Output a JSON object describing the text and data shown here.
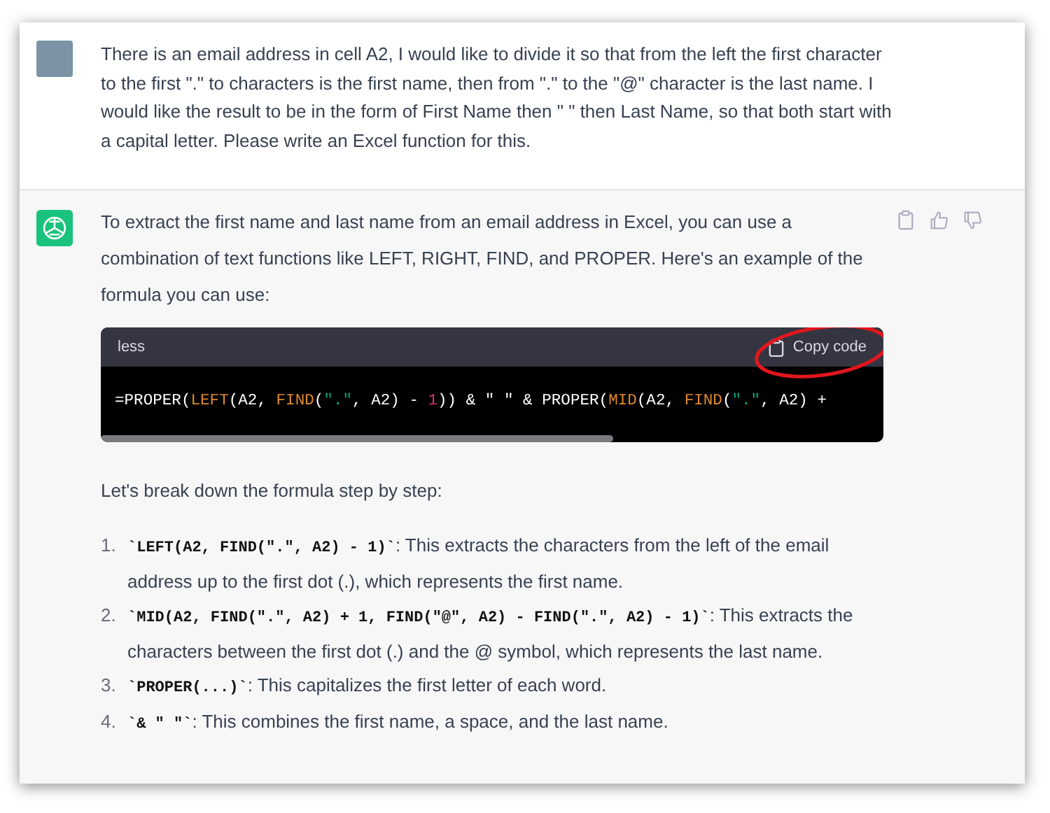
{
  "user_message": {
    "text": "There is an email address in cell A2, I would like to divide it so that from the left the first character to the first \".\" to characters is the first name, then from \".\" to the \"@\" character is the last name. I would like the result to be in the form of First Name then \" \" then Last Name, so that both start with a capital letter. Please write an Excel function for this."
  },
  "assistant_message": {
    "intro": "To extract the first name and last name from an email address in Excel, you can use a combination of text functions like LEFT, RIGHT, FIND, and PROPER. Here's an example of the formula you can use:",
    "code_block": {
      "language": "less",
      "copy_label": "Copy code",
      "copy_circled": true,
      "tokens": [
        {
          "text": "=PROPER(",
          "kind": "plain"
        },
        {
          "text": "LEFT",
          "kind": "func"
        },
        {
          "text": "(A2, ",
          "kind": "plain"
        },
        {
          "text": "FIND",
          "kind": "func"
        },
        {
          "text": "(",
          "kind": "plain"
        },
        {
          "text": "\".\"",
          "kind": "string"
        },
        {
          "text": ", A2) - ",
          "kind": "plain"
        },
        {
          "text": "1",
          "kind": "number"
        },
        {
          "text": ")) & \" \" & PROPER(",
          "kind": "plain"
        },
        {
          "text": "MID",
          "kind": "func"
        },
        {
          "text": "(A2, ",
          "kind": "plain"
        },
        {
          "text": "FIND",
          "kind": "func"
        },
        {
          "text": "(",
          "kind": "plain"
        },
        {
          "text": "\".\"",
          "kind": "string"
        },
        {
          "text": ", A2) +",
          "kind": "plain"
        }
      ]
    },
    "breakdown_intro": "Let's break down the formula step by step:",
    "steps": [
      {
        "number": "1.",
        "code": "`LEFT(A2, FIND(\".\", A2) - 1)`",
        "text": ": This extracts the characters from the left of the email address up to the first dot (.), which represents the first name."
      },
      {
        "number": "2.",
        "code": "`MID(A2, FIND(\".\", A2) + 1, FIND(\"@\", A2) - FIND(\".\", A2) - 1)`",
        "text": ": This extracts the characters between the first dot (.) and the @ symbol, which represents the last name."
      },
      {
        "number": "3.",
        "code": "`PROPER(...)`",
        "text": ": This capitalizes the first letter of each word."
      },
      {
        "number": "4.",
        "code": "`& \" \"`",
        "text": ": This combines the first name, a space, and the last name."
      }
    ]
  }
}
